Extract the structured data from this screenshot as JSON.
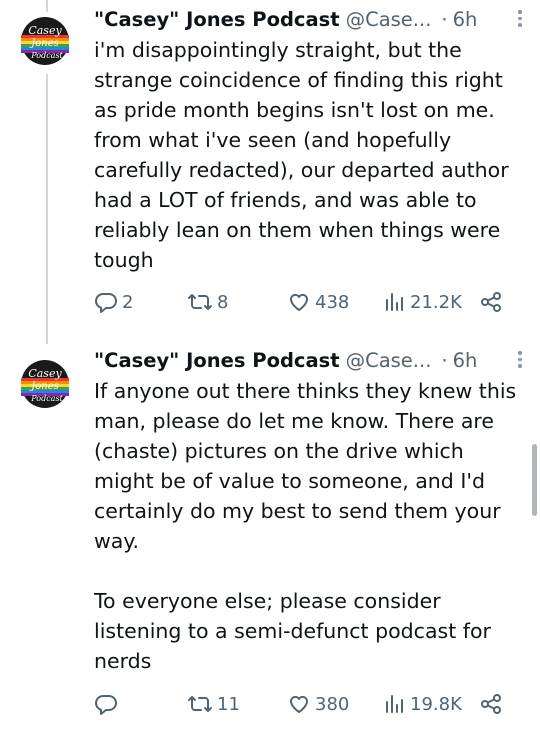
{
  "tweets": [
    {
      "author_name": "\"Casey\" Jones Podcast",
      "handle": "@Case...",
      "separator": "·",
      "time": "6h",
      "avatar_text": [
        "Casey",
        "Jones",
        "Podcast"
      ],
      "text": "i'm disappointingly straight, but the\nstrange coincidence of finding this right\nas pride month begins isn't lost on me.\nfrom what i've seen (and hopefully\ncarefully redacted), our departed author\nhad a LOT of friends, and was able to\nreliably lean on them when things were\ntough",
      "replies": "2",
      "reposts": "8",
      "likes": "438",
      "views": "21.2K"
    },
    {
      "author_name": "\"Casey\" Jones Podcast",
      "handle": "@Case...",
      "separator": "·",
      "time": "6h",
      "avatar_text": [
        "Casey",
        "Jones",
        "Podcast"
      ],
      "text": "If anyone out there thinks they knew this\nman, please do let me know. There are\n(chaste) pictures on the drive which\nmight be of value to someone, and I'd\ncertainly do my best to send them your\nway.\n\nTo everyone else; please consider\nlistening to a semi-defunct podcast for\nnerds",
      "replies": "",
      "reposts": "11",
      "likes": "380",
      "views": "19.8K"
    }
  ],
  "icons": [
    "reply-icon",
    "repost-icon",
    "like-icon",
    "views-icon",
    "share-icon",
    "more-icon"
  ],
  "colors": {
    "text": "#0f1419",
    "secondary": "#536471",
    "thread_line": "#cfd9de"
  }
}
